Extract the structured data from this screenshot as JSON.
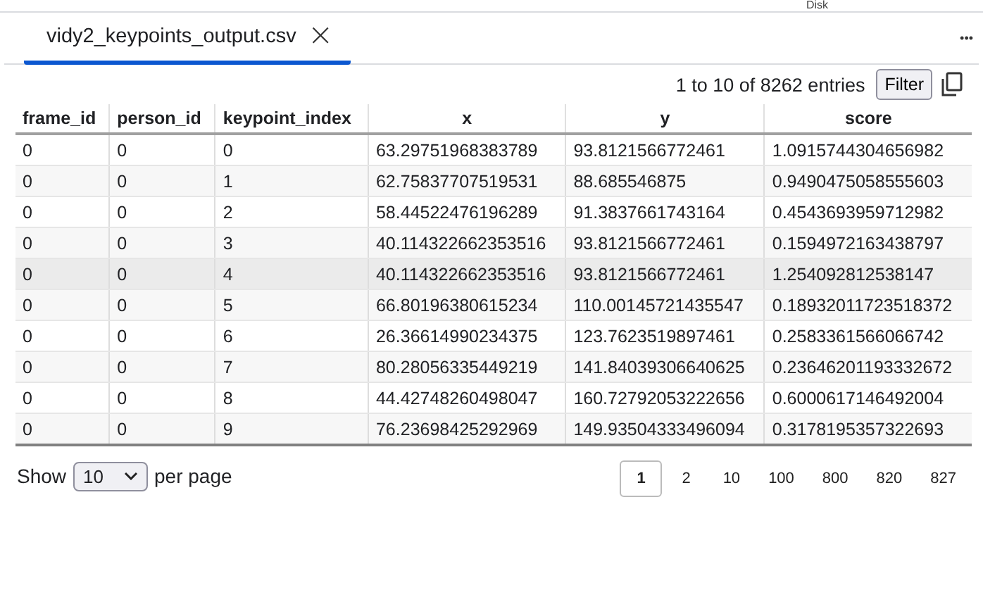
{
  "top_bar": {
    "label": "Disk"
  },
  "tabs": [
    {
      "label": "vidy2_keypoints_output.csv",
      "selected": true,
      "close": "×"
    }
  ],
  "more_menu": "•••",
  "table_info": {
    "entries": "1 to 10 of 8262 entries",
    "filter_button": "Filter"
  },
  "table": {
    "columns": [
      {
        "label": "frame_id",
        "kind": "integer"
      },
      {
        "label": "person_id",
        "kind": "integer"
      },
      {
        "label": "keypoint_index",
        "kind": "integer"
      },
      {
        "label": "x",
        "kind": "float"
      },
      {
        "label": "y",
        "kind": "float"
      },
      {
        "label": "score",
        "kind": "float"
      }
    ],
    "rows": [
      {
        "highlighted": false,
        "cells": [
          "0",
          "0",
          "0",
          "63.29751968383789",
          "93.8121566772461",
          "1.0915744304656982"
        ]
      },
      {
        "highlighted": false,
        "cells": [
          "0",
          "0",
          "1",
          "62.75837707519531",
          "88.685546875",
          "0.9490475058555603"
        ]
      },
      {
        "highlighted": false,
        "cells": [
          "0",
          "0",
          "2",
          "58.44522476196289",
          "91.3837661743164",
          "0.4543693959712982"
        ]
      },
      {
        "highlighted": false,
        "cells": [
          "0",
          "0",
          "3",
          "40.114322662353516",
          "93.8121566772461",
          "0.1594972163438797"
        ]
      },
      {
        "highlighted": true,
        "cells": [
          "0",
          "0",
          "4",
          "40.114322662353516",
          "93.8121566772461",
          "1.254092812538147"
        ]
      },
      {
        "highlighted": false,
        "cells": [
          "0",
          "0",
          "5",
          "66.80196380615234",
          "110.00145721435547",
          "0.18932011723518372"
        ]
      },
      {
        "highlighted": false,
        "cells": [
          "0",
          "0",
          "6",
          "26.36614990234375",
          "123.7623519897461",
          "0.2583361566066742"
        ]
      },
      {
        "highlighted": false,
        "cells": [
          "0",
          "0",
          "7",
          "80.28056335449219",
          "141.84039306640625",
          "0.23646201193332672"
        ]
      },
      {
        "highlighted": false,
        "cells": [
          "0",
          "0",
          "8",
          "44.42748260498047",
          "160.72792053222656",
          "0.6000617146492004"
        ]
      },
      {
        "highlighted": false,
        "cells": [
          "0",
          "0",
          "9",
          "76.23698425292969",
          "149.93504333496094",
          "0.3178195357322693"
        ]
      }
    ]
  },
  "footer": {
    "show_label": "Show",
    "page_size": "10",
    "per_page_label": "per page",
    "pages": [
      {
        "label": "1",
        "selected": true
      },
      {
        "label": "2",
        "selected": false
      },
      {
        "label": "10",
        "selected": false
      },
      {
        "label": "100",
        "selected": false
      },
      {
        "label": "800",
        "selected": false
      },
      {
        "label": "820",
        "selected": false
      },
      {
        "label": "827",
        "selected": false
      }
    ]
  }
}
